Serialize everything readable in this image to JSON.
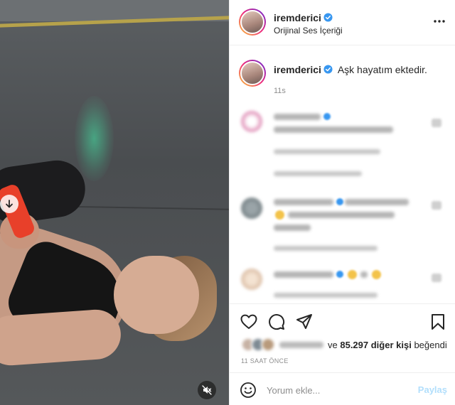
{
  "header": {
    "username": "iremderici",
    "subtitle": "Orijinal Ses İçeriği",
    "more_icon": "more-horizontal-icon"
  },
  "caption": {
    "username": "iremderici",
    "text": "Aşk hayatım ektedir.",
    "time": "11s"
  },
  "actions": {
    "like_icon": "heart-icon",
    "comment_icon": "comment-icon",
    "share_icon": "paper-plane-icon",
    "save_icon": "bookmark-icon"
  },
  "likes": {
    "connector": "ve",
    "count_text": "85.297 diğer kişi",
    "suffix": "beğendi"
  },
  "time_ago": "11 SAAT ÖNCE",
  "add_comment": {
    "placeholder": "Yorum ekle...",
    "post_label": "Paylaş"
  },
  "colors": {
    "verified": "#3897f0",
    "post_disabled": "#b2dffc",
    "meta_gray": "#8e8e8e"
  }
}
